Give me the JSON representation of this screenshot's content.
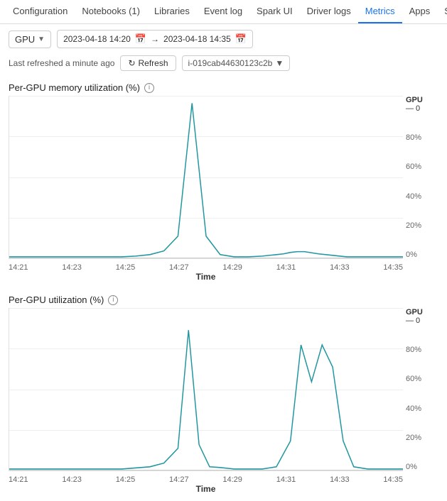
{
  "nav": {
    "tabs": [
      {
        "label": "Configuration",
        "active": false
      },
      {
        "label": "Notebooks (1)",
        "active": false
      },
      {
        "label": "Libraries",
        "active": false
      },
      {
        "label": "Event log",
        "active": false
      },
      {
        "label": "Spark UI",
        "active": false
      },
      {
        "label": "Driver logs",
        "active": false
      },
      {
        "label": "Metrics",
        "active": true
      },
      {
        "label": "Apps",
        "active": false
      },
      {
        "label": "Spark cluster U",
        "active": false
      }
    ]
  },
  "toolbar": {
    "gpu_label": "GPU",
    "date_start": "2023-04-18 14:20",
    "date_arrow": "→",
    "date_end": "2023-04-18 14:35",
    "last_refreshed": "Last refreshed a minute ago",
    "refresh_label": "Refresh",
    "instance_id": "i-019cab44630123c2b"
  },
  "charts": [
    {
      "id": "memory",
      "title": "Per-GPU memory utilization (%)",
      "legend_title": "GPU",
      "legend_item": "— 0",
      "y_labels": [
        "80%",
        "60%",
        "40%",
        "20%",
        "0%"
      ],
      "x_labels": [
        "14:21",
        "14:23",
        "14:25",
        "14:27",
        "14:29",
        "14:31",
        "14:33",
        "14:35"
      ],
      "x_title": "Time",
      "peak_x": 0.47,
      "peak_height": 0.88,
      "peak_width": 0.07,
      "secondary_peak": false
    },
    {
      "id": "utilization",
      "title": "Per-GPU utilization (%)",
      "legend_title": "GPU",
      "legend_item": "— 0",
      "y_labels": [
        "80%",
        "60%",
        "40%",
        "20%",
        "0%"
      ],
      "x_labels": [
        "14:21",
        "14:23",
        "14:25",
        "14:27",
        "14:29",
        "14:31",
        "14:33",
        "14:35"
      ],
      "x_title": "Time",
      "secondary_peak": true
    }
  ]
}
